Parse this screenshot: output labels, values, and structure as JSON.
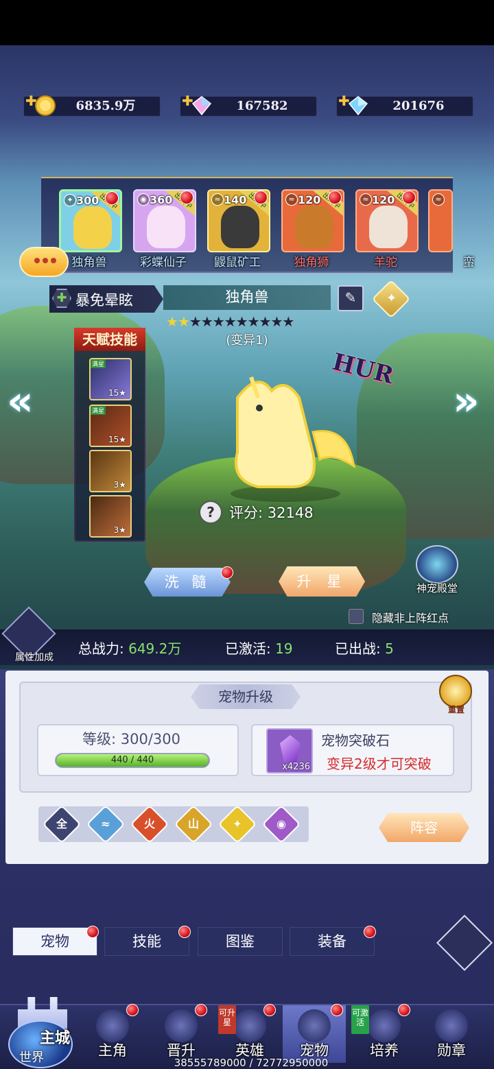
{
  "resources": [
    {
      "icon": "gold-coin-icon",
      "value": "6835.9万"
    },
    {
      "icon": "rainbow-diamond-icon",
      "value": "167582"
    },
    {
      "icon": "blue-diamond-icon",
      "value": "201676"
    }
  ],
  "pet_strip": [
    {
      "level": "300",
      "name": "独角兽",
      "tag": "出战中",
      "bg": "#7fd0e6"
    },
    {
      "level": "360",
      "name": "彩蝶仙子",
      "tag": "出战中",
      "bg": "#d7a5f0"
    },
    {
      "level": "140",
      "name": "鼹鼠矿工",
      "tag": "出战中",
      "bg": "#e2b23a"
    },
    {
      "level": "120",
      "name": "独角狮",
      "tag": "出战中",
      "bg": "#e86a3a"
    },
    {
      "level": "120",
      "name": "羊驼",
      "tag": "出战中",
      "bg": "#e96a4a"
    },
    {
      "level": "",
      "name": "蛮",
      "tag": "",
      "bg": "#e86a3a"
    }
  ],
  "selected_pet": {
    "skill": "暴免晕眩",
    "name": "独角兽",
    "stars_total": 11,
    "stars_lit": 2,
    "mutation": "(变异1)",
    "score_label": "评分:",
    "score": "32148"
  },
  "talent": {
    "title": "天赋技能",
    "slots": [
      {
        "level": "15",
        "corner": "满星",
        "color": "#8a7ad8"
      },
      {
        "level": "15",
        "corner": "满星",
        "color": "#b0502a"
      },
      {
        "level": "3",
        "corner": "",
        "color": "#c28a3a"
      },
      {
        "level": "3",
        "corner": "",
        "color": "#c06e3a"
      }
    ]
  },
  "decor_text": "HUR",
  "buttons": {
    "wash": "洗 髓",
    "upstar": "升 星",
    "temple": "神宠殿堂",
    "hide_red": "隐藏非上阵红点"
  },
  "stats": {
    "attr_bonus": "属性加成",
    "power_label": "总战力:",
    "power": "649.2万",
    "activated_label": "已激活:",
    "activated": "19",
    "deployed_label": "已出战:",
    "deployed": "5"
  },
  "upgrade": {
    "title": "宠物升级",
    "reset": "重置",
    "level_label": "等级:",
    "level_value": "300/300",
    "exp_text": "440 / 440",
    "exp_fraction": 1.0,
    "stone_name": "宠物突破石",
    "stone_qty": "x4236",
    "stone_warning": "变异2级才可突破"
  },
  "filters": [
    {
      "label": "全",
      "icon": "all-filter-icon",
      "color": "#3e4470"
    },
    {
      "label": "≈",
      "icon": "water-element-icon",
      "color": "#5aa0d8"
    },
    {
      "label": "火",
      "icon": "fire-element-icon",
      "color": "#d8502a"
    },
    {
      "label": "山",
      "icon": "earth-element-icon",
      "color": "#d8a42a"
    },
    {
      "label": "✦",
      "icon": "light-element-icon",
      "color": "#e8c42a"
    },
    {
      "label": "◉",
      "icon": "dark-element-icon",
      "color": "#a05ac8"
    }
  ],
  "lineup_label": "阵容",
  "tabs": [
    "宠物",
    "技能",
    "图鉴",
    "装备"
  ],
  "nav": {
    "world_main": "主城",
    "world_sub": "世界",
    "items": [
      "主角",
      "晋升",
      "英雄",
      "宠物",
      "培养",
      "勋章"
    ],
    "badge_upstar": "可升星",
    "badge_activate": "可激活"
  },
  "bottom_info": "38555789000 / 72772950000"
}
